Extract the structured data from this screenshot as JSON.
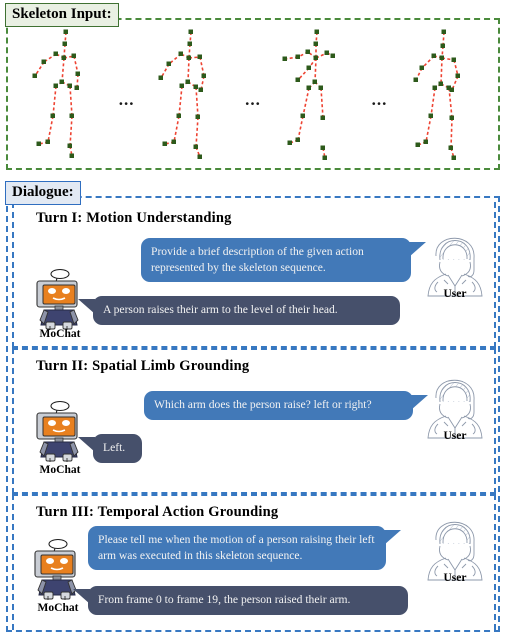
{
  "sections": {
    "skeleton": {
      "label": "Skeleton Input:",
      "border_color": "#4a8a3c",
      "tag_bg": "#e9f0e3",
      "ellipsis": "...",
      "frame_count": 4,
      "joint_color": "#2d5a1b",
      "bone_color": "#ee4433"
    },
    "dialogue": {
      "label": "Dialogue:",
      "border_color": "#3778c2",
      "tag_bg": "#e2e9f3"
    }
  },
  "colors": {
    "user_bubble": "#4279b8",
    "bot_bubble": "#46506b",
    "green_accent": "#4a8a3c",
    "blue_accent": "#3778c2",
    "robot_face": "#e8801f",
    "robot_body": "#3e4470"
  },
  "speakers": {
    "user_name": "User",
    "bot_name": "MoChat"
  },
  "turns": [
    {
      "title": "Turn I: Motion Understanding",
      "user_message": "Provide a brief description of the given action represented by the skeleton sequence.",
      "bot_message": "A person raises their arm to the level of their head."
    },
    {
      "title": "Turn II: Spatial Limb Grounding",
      "user_message": "Which arm does the person raise? left or right?",
      "bot_message": "Left."
    },
    {
      "title": "Turn III: Temporal Action Grounding",
      "user_message": "Please tell me when the motion of a person raising their left arm was executed in this skeleton sequence.",
      "bot_message": "From frame 0 to frame 19, the person raised their arm."
    }
  ]
}
